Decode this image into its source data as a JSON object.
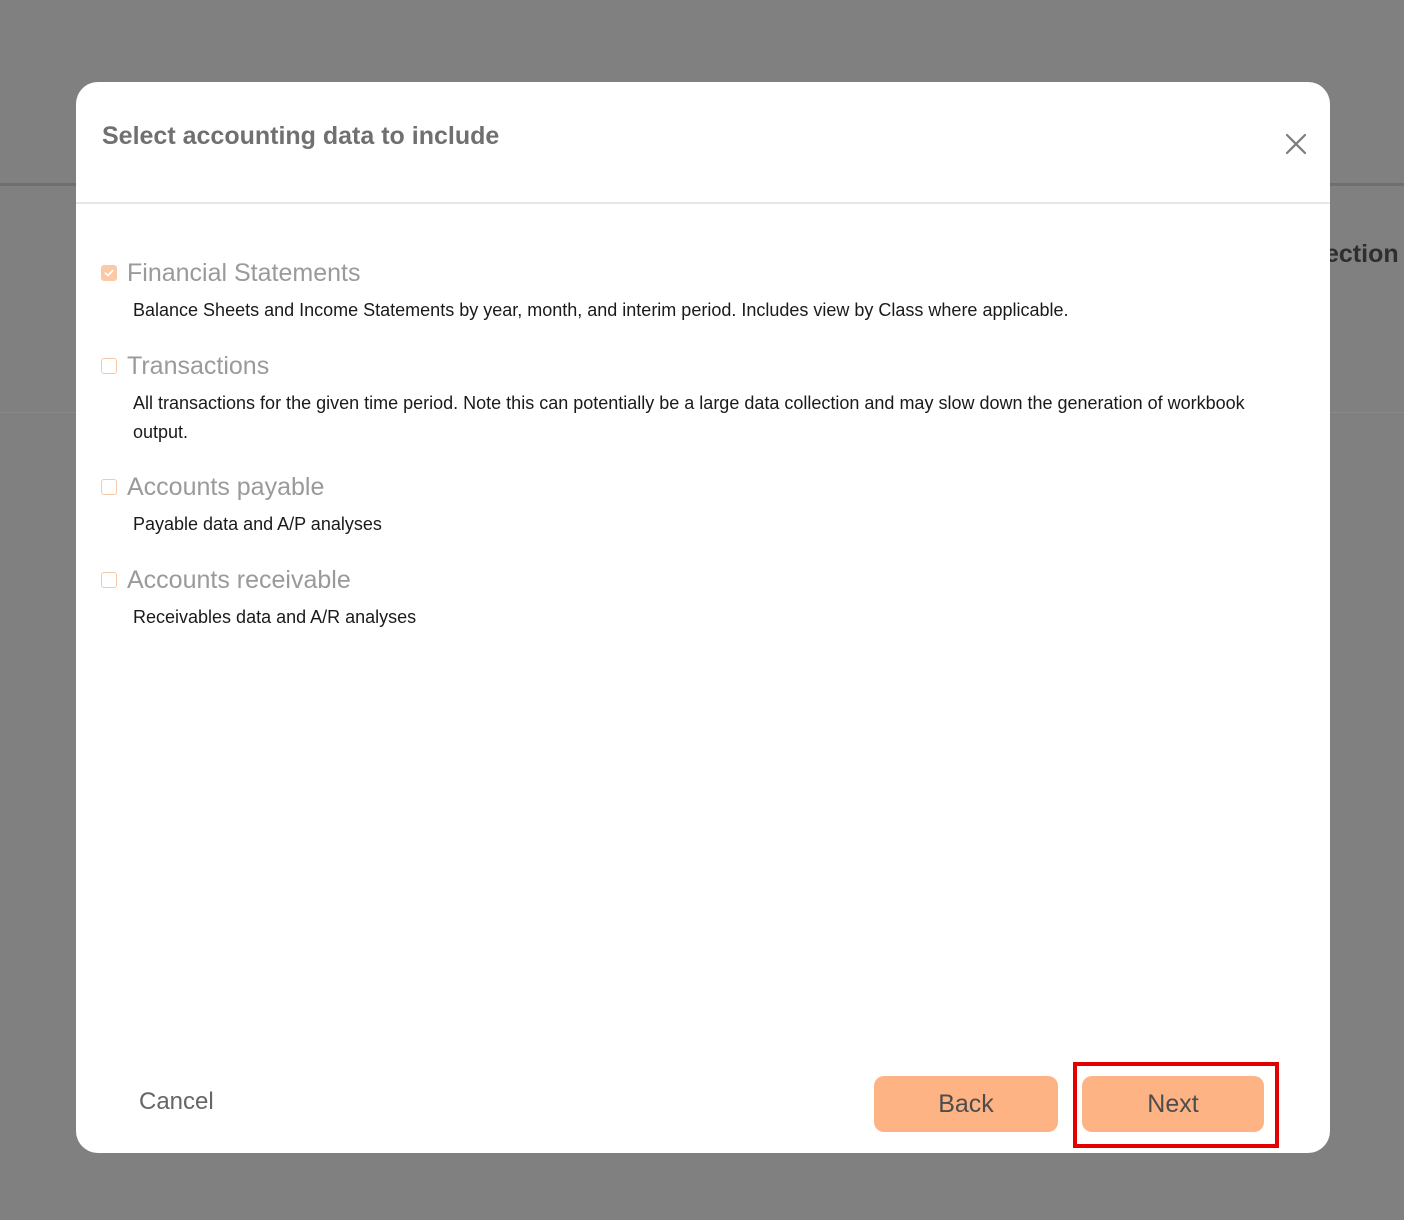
{
  "background": {
    "section_fragment": "ection"
  },
  "modal": {
    "title": "Select accounting data to include",
    "options": [
      {
        "label": "Financial Statements",
        "checked": true,
        "description": "Balance Sheets and Income Statements by year, month, and interim period. Includes view by Class where applicable."
      },
      {
        "label": "Transactions",
        "checked": false,
        "description": "All transactions for the given time period. Note this can potentially be a large data collection and may slow down the generation of workbook output."
      },
      {
        "label": "Accounts payable",
        "checked": false,
        "description": "Payable data and A/P analyses"
      },
      {
        "label": "Accounts receivable",
        "checked": false,
        "description": "Receivables data and A/R analyses"
      }
    ],
    "footer": {
      "cancel_label": "Cancel",
      "back_label": "Back",
      "next_label": "Next"
    }
  },
  "colors": {
    "accent": "#fdb384",
    "highlight": "#e30000",
    "overlay": "#808080"
  }
}
